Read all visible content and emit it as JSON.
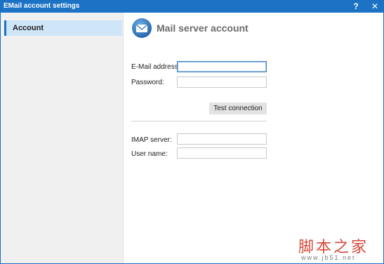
{
  "window": {
    "title": "EMail account settings",
    "help_label": "?",
    "close_label": "✕"
  },
  "sidebar": {
    "items": [
      {
        "label": "Account",
        "selected": true
      }
    ]
  },
  "main": {
    "icon": "mail-envelope-icon",
    "title": "Mail server account",
    "email": {
      "label": "E-Mail address:",
      "value": "",
      "placeholder": ""
    },
    "password": {
      "label": "Password:",
      "value": ""
    },
    "test_button": "Test connection",
    "imap": {
      "label": "IMAP server:",
      "value": ""
    },
    "username": {
      "label": "User name:",
      "value": ""
    }
  },
  "watermark": {
    "text": "脚本之家",
    "url": "www.jb51.net"
  },
  "colors": {
    "titlebar": "#1c72c4",
    "sidebar": "#f0f0f0",
    "selected_item": "#cfe5f8",
    "watermark": "#d64a3a"
  }
}
